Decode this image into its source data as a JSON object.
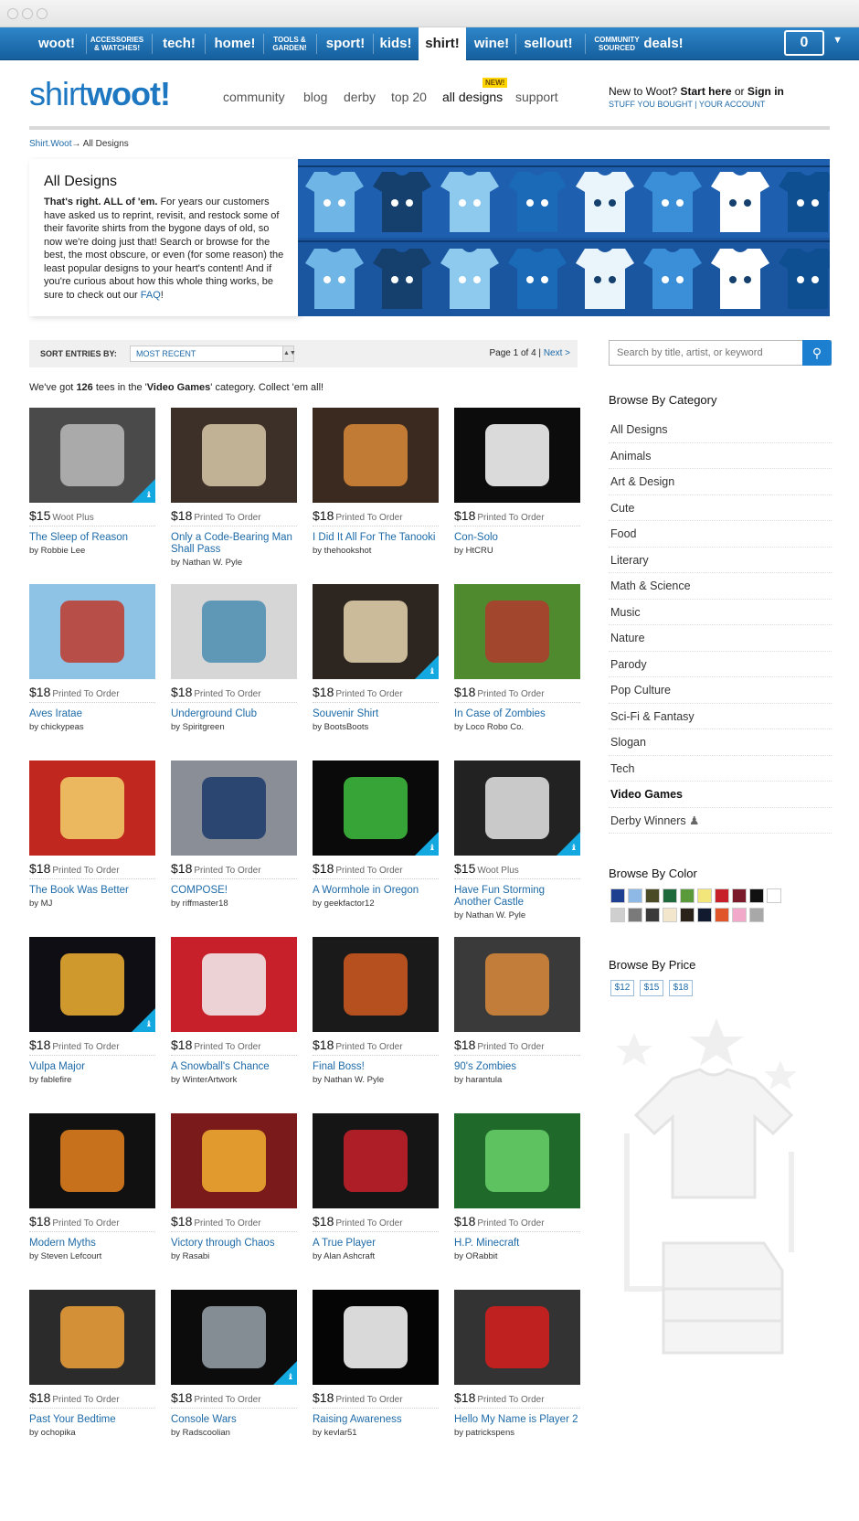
{
  "topnav": {
    "items": [
      {
        "label": "woot!",
        "small": false,
        "active": false
      },
      {
        "label": "ACCESSORIES & WATCHES!",
        "small": true,
        "active": false
      },
      {
        "label": "tech!",
        "small": false,
        "active": false
      },
      {
        "label": "home!",
        "small": false,
        "active": false
      },
      {
        "label": "TOOLS & GARDEN!",
        "small": true,
        "active": false
      },
      {
        "label": "sport!",
        "small": false,
        "active": false
      },
      {
        "label": "kids!",
        "small": false,
        "active": false
      },
      {
        "label": "shirt!",
        "small": false,
        "active": true
      },
      {
        "label": "wine!",
        "small": false,
        "active": false
      },
      {
        "label": "sellout!",
        "small": false,
        "active": false
      },
      {
        "label": "COMMUNITY SOURCED",
        "small": true,
        "active": false
      },
      {
        "label": "deals!",
        "small": false,
        "active": false
      }
    ],
    "cart_count": "0"
  },
  "header": {
    "logo_shirt": "shirt",
    "logo_woot": "woot!",
    "nav": [
      "community",
      "blog",
      "derby",
      "top 20",
      "all designs",
      "support"
    ],
    "new_badge": "NEW!",
    "account_prefix": "New to Woot?",
    "start_here": "Start here",
    "or": "or",
    "sign_in": "Sign in",
    "account_links": "STUFF YOU BOUGHT | YOUR ACCOUNT"
  },
  "breadcrumb": {
    "root": "Shirt.Woot",
    "arrow": "→",
    "current": "All Designs"
  },
  "intro": {
    "heading": "All Designs",
    "lead": "That's right. ALL of 'em.",
    "body": " For years our customers have asked us to reprint, revisit, and restock some of their favorite shirts from the bygone days of old, so now we're doing just that! Search or browse for the best, the most obscure, or even (for some reason) the least popular designs to your heart's content! And if you're curious about how this whole thing works, be sure to check out our ",
    "faq": "FAQ",
    "end": "!"
  },
  "sort": {
    "label": "SORT ENTRIES BY:",
    "selected": "MOST RECENT",
    "page_text": "Page 1 of 4 |",
    "next": "Next >"
  },
  "count": {
    "pre": "We've got ",
    "n": "126",
    "mid": " tees in the '",
    "cat": "Video Games",
    "post": "' category. Collect 'em all!"
  },
  "items": [
    {
      "price": "$15",
      "type": "Woot Plus",
      "title": "The Sleep of Reason",
      "by": "by Robbie Lee",
      "bg": "#4a4a4a",
      "accent": "#bbbbbb",
      "badge": true
    },
    {
      "price": "$18",
      "type": "Printed To Order",
      "title": "Only a Code-Bearing Man Shall Pass",
      "by": "by Nathan W. Pyle",
      "bg": "#3d3028",
      "accent": "#d9c9a8",
      "badge": false
    },
    {
      "price": "$18",
      "type": "Printed To Order",
      "title": "I Did It All For The Tanooki",
      "by": "by thehookshot",
      "bg": "#3a2a1f",
      "accent": "#d98a3a",
      "badge": false
    },
    {
      "price": "$18",
      "type": "Printed To Order",
      "title": "Con-Solo",
      "by": "by HtCRU",
      "bg": "#0c0c0c",
      "accent": "#ffffff",
      "badge": false
    },
    {
      "price": "$18",
      "type": "Printed To Order",
      "title": "Aves Iratae",
      "by": "by chickypeas",
      "bg": "#8ec3e6",
      "accent": "#c0392b",
      "badge": false
    },
    {
      "price": "$18",
      "type": "Printed To Order",
      "title": "Underground Club",
      "by": "by Spiritgreen",
      "bg": "#d6d6d6",
      "accent": "#4a8db0",
      "badge": false
    },
    {
      "price": "$18",
      "type": "Printed To Order",
      "title": "Souvenir Shirt",
      "by": "by BootsBoots",
      "bg": "#2d2620",
      "accent": "#e8d6b0",
      "badge": true
    },
    {
      "price": "$18",
      "type": "Printed To Order",
      "title": "In Case of Zombies",
      "by": "by Loco Robo Co.",
      "bg": "#4f8a2f",
      "accent": "#b03a2e",
      "badge": false
    },
    {
      "price": "$18",
      "type": "Printed To Order",
      "title": "The Book Was Better",
      "by": "by MJ",
      "bg": "#c0281f",
      "accent": "#f2d06b",
      "badge": false
    },
    {
      "price": "$18",
      "type": "Printed To Order",
      "title": "COMPOSE!",
      "by": "by riffmaster18",
      "bg": "#8a8e96",
      "accent": "#1a3a6b",
      "badge": false
    },
    {
      "price": "$18",
      "type": "Printed To Order",
      "title": "A Wormhole in Oregon",
      "by": "by geekfactor12",
      "bg": "#0a0a0a",
      "accent": "#3fbf3f",
      "badge": true
    },
    {
      "price": "$15",
      "type": "Woot Plus",
      "title": "Have Fun Storming Another Castle",
      "by": "by Nathan W. Pyle",
      "bg": "#222222",
      "accent": "#e6e6e6",
      "badge": true
    },
    {
      "price": "$18",
      "type": "Printed To Order",
      "title": "Vulpa Major",
      "by": "by fablefire",
      "bg": "#0e0e14",
      "accent": "#f2b233",
      "badge": true
    },
    {
      "price": "$18",
      "type": "Printed To Order",
      "title": "A Snowball's Chance",
      "by": "by WinterArtwork",
      "bg": "#c8202a",
      "accent": "#f2f2f2",
      "badge": false
    },
    {
      "price": "$18",
      "type": "Printed To Order",
      "title": "Final Boss!",
      "by": "by Nathan W. Pyle",
      "bg": "#1a1a1a",
      "accent": "#d25a20",
      "badge": false
    },
    {
      "price": "$18",
      "type": "Printed To Order",
      "title": "90's Zombies",
      "by": "by harantula",
      "bg": "#3a3a3a",
      "accent": "#d98a3a",
      "badge": false
    },
    {
      "price": "$18",
      "type": "Printed To Order",
      "title": "Modern Myths",
      "by": "by Steven Lefcourt",
      "bg": "#111111",
      "accent": "#e8821e",
      "badge": false
    },
    {
      "price": "$18",
      "type": "Printed To Order",
      "title": "Victory through Chaos",
      "by": "by Rasabi",
      "bg": "#7a1a1a",
      "accent": "#f2b233",
      "badge": false
    },
    {
      "price": "$18",
      "type": "Printed To Order",
      "title": "A True Player",
      "by": "by Alan Ashcraft",
      "bg": "#151515",
      "accent": "#c8202a",
      "badge": false
    },
    {
      "price": "$18",
      "type": "Printed To Order",
      "title": "H.P. Minecraft",
      "by": "by ORabbit",
      "bg": "#1f6a2a",
      "accent": "#6bd16b",
      "badge": false
    },
    {
      "price": "$18",
      "type": "Printed To Order",
      "title": "Past Your Bedtime",
      "by": "by ochopika",
      "bg": "#2b2b2b",
      "accent": "#f2a23a",
      "badge": false
    },
    {
      "price": "$18",
      "type": "Printed To Order",
      "title": "Console Wars",
      "by": "by Radscoolian",
      "bg": "#0c0c0c",
      "accent": "#9aa3ad",
      "badge": true
    },
    {
      "price": "$18",
      "type": "Printed To Order",
      "title": "Raising Awareness",
      "by": "by kevlar51",
      "bg": "#050505",
      "accent": "#ffffff",
      "badge": false
    },
    {
      "price": "$18",
      "type": "Printed To Order",
      "title": "Hello My Name is Player 2",
      "by": "by patrickspens",
      "bg": "#333333",
      "accent": "#d81e1e",
      "badge": false
    }
  ],
  "sidebar": {
    "search_placeholder": "Search by title, artist, or keyword",
    "category_heading": "Browse By Category",
    "categories": [
      "All Designs",
      "Animals",
      "Art & Design",
      "Cute",
      "Food",
      "Literary",
      "Math & Science",
      "Music",
      "Nature",
      "Parody",
      "Pop Culture",
      "Sci-Fi & Fantasy",
      "Slogan",
      "Tech",
      "Video Games",
      "Derby Winners"
    ],
    "current_category": "Video Games",
    "color_heading": "Browse By Color",
    "colors": [
      "#1e3f8f",
      "#8eb8e6",
      "#4a4a26",
      "#1f6a3a",
      "#5a9a3a",
      "#f2e67a",
      "#c8202a",
      "#7a1a2a",
      "#111111",
      "#ffffff",
      "#cfcfcf",
      "#7a7a7a",
      "#3a3a3a",
      "#f2e6cc",
      "#2b2219",
      "#111a2e",
      "#e0552a",
      "#f2a8c8",
      "#a8a8a8"
    ],
    "price_heading": "Browse By Price",
    "prices": [
      "$12",
      "$15",
      "$18"
    ]
  }
}
